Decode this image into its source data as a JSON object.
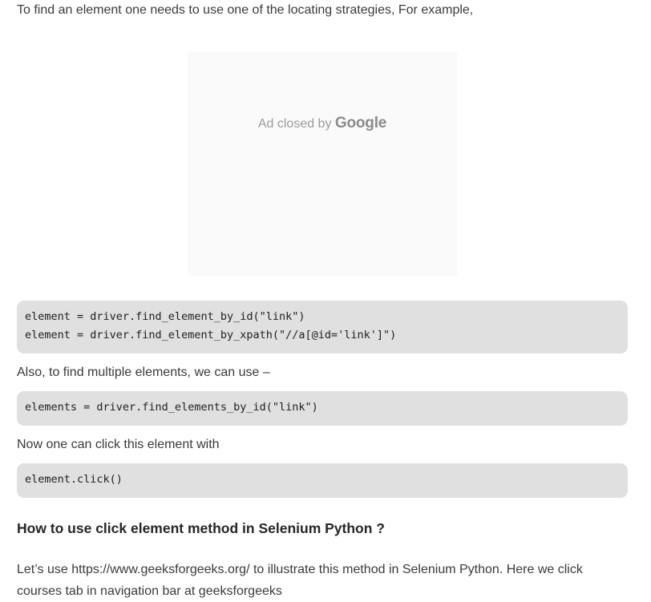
{
  "article": {
    "intro": "To find an element one needs to use one of the locating strategies, For example,",
    "ad": {
      "prefix": "Ad closed by",
      "brand": "Google"
    },
    "code_block_1": [
      "element = driver.find_element_by_id(\"link\")",
      "element = driver.find_element_by_xpath(\"//a[@id='link']\")"
    ],
    "para_multiple": "Also, to find multiple elements, we can use –",
    "code_block_2": [
      "elements = driver.find_elements_by_id(\"link\")"
    ],
    "para_click": "Now one can click this element with",
    "code_block_3": [
      "element.click()"
    ],
    "heading": "How to use click element method in Selenium Python ?",
    "para_lets_line1": "Let’s use https://www.geeksforgeeks.org/ to illustrate this method in Selenium Python. Here we click",
    "para_lets_line2": "courses tab in navigation bar at geeksforgeeks"
  }
}
